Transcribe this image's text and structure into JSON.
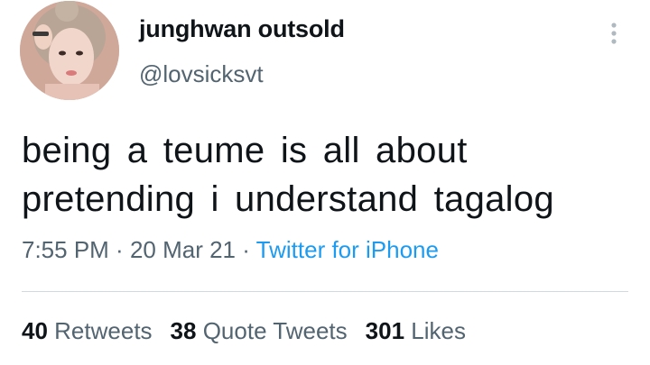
{
  "author": {
    "display_name": "junghwan outsold",
    "handle": "@lovsicksvt",
    "avatar_icon": "profile-photo"
  },
  "menu": {
    "icon": "more-vertical-icon"
  },
  "tweet": {
    "line1": "being a teume is all about",
    "line2": "pretending i understand tagalog"
  },
  "meta": {
    "time": "7:55 PM",
    "sep1": " · ",
    "date": "20 Mar 21",
    "sep2": " · ",
    "source": "Twitter for iPhone"
  },
  "stats": {
    "retweets_count": "40",
    "retweets_label": "Retweets",
    "quotes_count": "38",
    "quotes_label": "Quote Tweets",
    "likes_count": "301",
    "likes_label": "Likes"
  },
  "colors": {
    "text": "#0f1419",
    "secondary": "#536471",
    "link": "#1d9bf0",
    "divider": "#cfd9de"
  }
}
